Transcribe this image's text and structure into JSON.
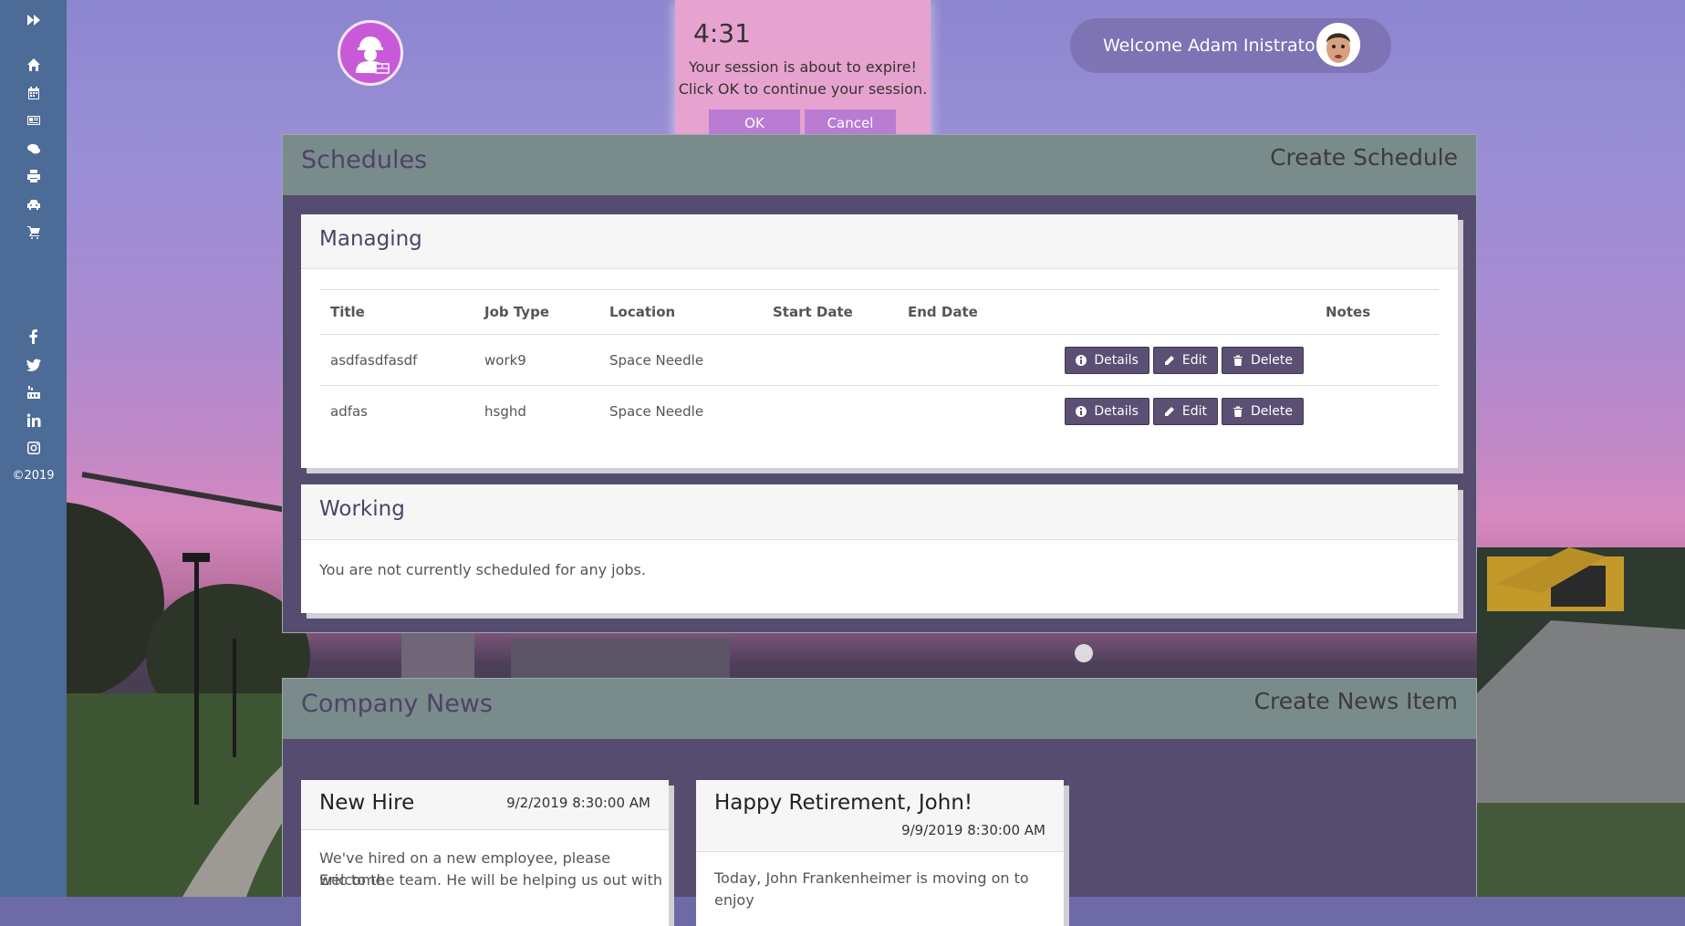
{
  "sidebar": {
    "icons": [
      "expand-icon",
      "home-icon",
      "calendar-icon",
      "news-icon",
      "chat-icon",
      "print-icon",
      "car-icon",
      "cart-icon"
    ],
    "social": [
      "facebook-icon",
      "twitter-icon",
      "youtube-icon",
      "linkedin-icon",
      "instagram-icon"
    ],
    "copyright": "©2019"
  },
  "header": {
    "welcome": "Welcome Adam Inistrator"
  },
  "session_dialog": {
    "timer": "4:31",
    "line1": "Your session is about to expire!",
    "line2": "Click OK to continue your session.",
    "ok": "OK",
    "cancel": "Cancel"
  },
  "schedules": {
    "title": "Schedules",
    "create": "Create Schedule",
    "managing": {
      "title": "Managing",
      "columns": [
        "Title",
        "Job Type",
        "Location",
        "Start Date",
        "End Date",
        "Notes"
      ],
      "rows": [
        {
          "title": "asdfasdfasdf",
          "job_type": "work9",
          "location": "Space Needle",
          "start": "",
          "end": ""
        },
        {
          "title": "adfas",
          "job_type": "hsghd",
          "location": "Space Needle",
          "start": "",
          "end": ""
        }
      ],
      "details": "Details",
      "edit": "Edit",
      "delete": "Delete"
    },
    "working": {
      "title": "Working",
      "message": "You are not currently scheduled for any jobs."
    }
  },
  "news": {
    "title": "Company News",
    "create": "Create News Item",
    "items": [
      {
        "title": "New Hire",
        "date": "9/2/2019 8:30:00 AM",
        "body1": "We've hired on a new employee, please welcome",
        "body2": "Eric to the team. He will be helping us out with"
      },
      {
        "title": "Happy Retirement, John!",
        "date": "9/9/2019 8:30:00 AM",
        "body1": "Today, John Frankenheimer is moving on to enjoy"
      }
    ]
  }
}
